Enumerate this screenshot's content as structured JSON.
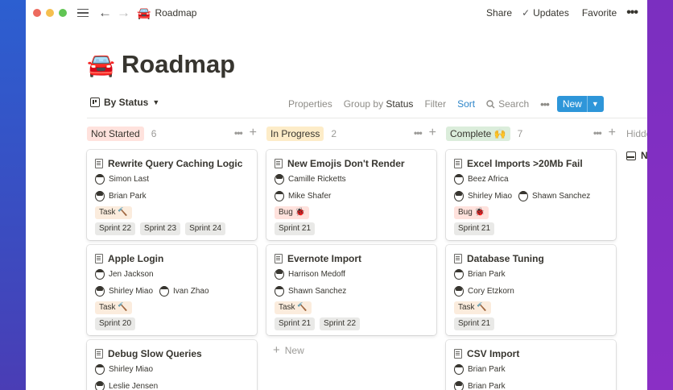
{
  "topbar": {
    "page_emoji": "🚘",
    "page_title": "Roadmap",
    "share": "Share",
    "updates": "Updates",
    "favorite": "Favorite",
    "more": "•••"
  },
  "page": {
    "emoji": "🚘",
    "title": "Roadmap"
  },
  "viewbar": {
    "view_name": "By Status",
    "properties": "Properties",
    "group_by_prefix": "Group by",
    "group_by_value": "Status",
    "filter": "Filter",
    "sort": "Sort",
    "search": "Search",
    "more": "•••",
    "new": "New"
  },
  "columns": [
    {
      "label": "Not Started",
      "count": "6",
      "color": "#ffe2dd",
      "cards": [
        {
          "title": "Rewrite Query Caching Logic",
          "people": [
            [
              "Simon Last"
            ],
            [
              "Brian Park"
            ]
          ],
          "tag": "Task 🔨",
          "tag_type": "task",
          "sprints": [
            "Sprint 22",
            "Sprint 23",
            "Sprint 24"
          ]
        },
        {
          "title": "Apple Login",
          "people": [
            [
              "Jen Jackson"
            ],
            [
              "Shirley Miao",
              "Ivan Zhao"
            ]
          ],
          "tag": "Task 🔨",
          "tag_type": "task",
          "sprints": [
            "Sprint 20"
          ]
        },
        {
          "title": "Debug Slow Queries",
          "people": [
            [
              "Shirley Miao"
            ],
            [
              "Leslie Jensen"
            ]
          ]
        }
      ]
    },
    {
      "label": "In Progress",
      "count": "2",
      "color": "#fdecc8",
      "cards": [
        {
          "title": "New Emojis Don't Render",
          "people": [
            [
              "Camille Ricketts"
            ],
            [
              "Mike Shafer"
            ]
          ],
          "tag": "Bug 🐞",
          "tag_type": "bug",
          "sprints": [
            "Sprint 21"
          ]
        },
        {
          "title": "Evernote Import",
          "people": [
            [
              "Harrison Medoff"
            ],
            [
              "Shawn Sanchez"
            ]
          ],
          "tag": "Task 🔨",
          "tag_type": "task",
          "sprints": [
            "Sprint 21",
            "Sprint 22"
          ]
        }
      ],
      "new_label": "New"
    },
    {
      "label": "Complete 🙌",
      "count": "7",
      "color": "#dbeddb",
      "cards": [
        {
          "title": "Excel Imports >20Mb Fail",
          "people": [
            [
              "Beez Africa"
            ],
            [
              "Shirley Miao",
              "Shawn Sanchez"
            ]
          ],
          "tag": "Bug 🐞",
          "tag_type": "bug",
          "sprints": [
            "Sprint 21"
          ]
        },
        {
          "title": "Database Tuning",
          "people": [
            [
              "Brian Park"
            ],
            [
              "Cory Etzkorn"
            ]
          ],
          "tag": "Task 🔨",
          "tag_type": "task",
          "sprints": [
            "Sprint 21"
          ]
        },
        {
          "title": "CSV Import",
          "people": [
            [
              "Brian Park"
            ],
            [
              "Brian Park"
            ]
          ]
        }
      ]
    }
  ],
  "hidden": {
    "label": "Hidde"
  }
}
